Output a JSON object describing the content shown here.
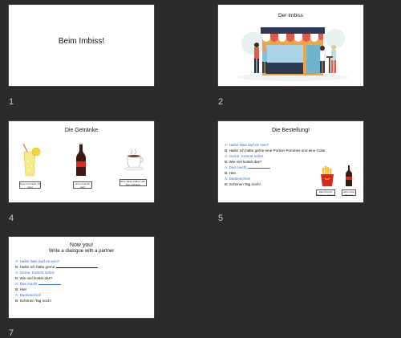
{
  "slides": [
    {
      "number": "1",
      "title": "Beim Imbiss!"
    },
    {
      "number": "2",
      "title": "Der Imbiss"
    },
    {
      "number": "4",
      "title": "Die Getränke",
      "labels": [
        "Eine Limonade 70 Cent",
        "Eine Cola 90 Cent",
        "Eine Tasse Kaffee oder Tee 1,20 Euro"
      ]
    },
    {
      "number": "5",
      "title": "Die Bestellung!",
      "lines": [
        {
          "speaker": "a",
          "text": "A: Hallo! Was darf es sein?"
        },
        {
          "speaker": "b",
          "text": "B: Hallo! Ich hätte gerne eine Portion Pommes und eine Cola!"
        },
        {
          "speaker": "a",
          "text": "A: Gerne. Kommt sofort."
        },
        {
          "speaker": "b",
          "text": "B: Wie viel kostet das?"
        },
        {
          "speaker": "a",
          "text": "A: Das macht"
        },
        {
          "speaker": "b",
          "text": "B: Hier."
        },
        {
          "speaker": "a",
          "text": "A: Dankeschön!"
        },
        {
          "speaker": "b",
          "text": "B: Schönen Tag noch!"
        }
      ],
      "labels": [
        "Eine Portion Pommes 2 Euro",
        "Eine Cola 90 Cent"
      ]
    },
    {
      "number": "7",
      "title": "Now you!",
      "subtitle": "Write a dialogue with a partner",
      "lines": [
        {
          "speaker": "a",
          "text": "A: Hallo! Was darf es sein?"
        },
        {
          "speaker": "b",
          "text": "B: Hallo! Ich hätte gerne"
        },
        {
          "speaker": "a",
          "text": "A: Gerne. Kommt sofort."
        },
        {
          "speaker": "b",
          "text": "B: Wie viel kostet das?"
        },
        {
          "speaker": "a",
          "text": "A: Das macht"
        },
        {
          "speaker": "b",
          "text": "B: Hier."
        },
        {
          "speaker": "a",
          "text": "A: Dankeschön!"
        },
        {
          "speaker": "b",
          "text": "B: Schönen Tag noch!"
        }
      ]
    }
  ],
  "colors": {
    "background": "#2b2b2b",
    "speaker_a": "#2f6fd6",
    "speaker_b": "#111111"
  }
}
